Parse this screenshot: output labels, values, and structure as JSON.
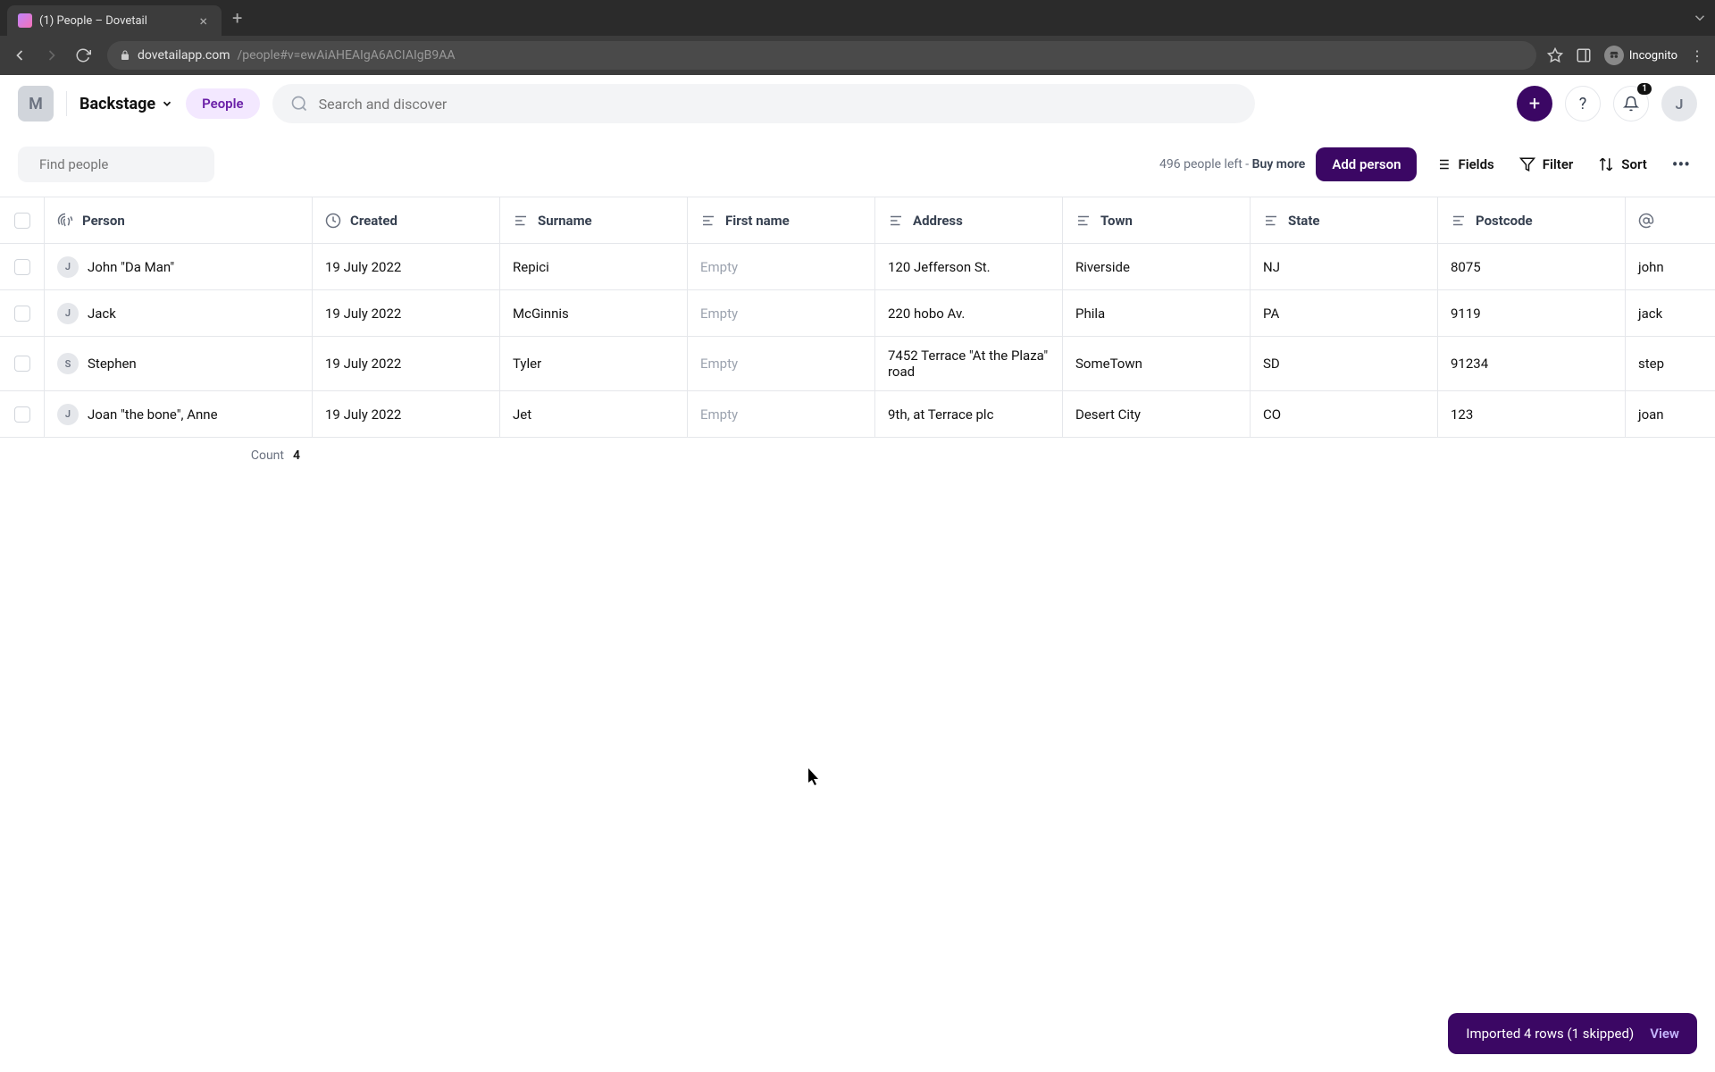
{
  "browser": {
    "tab_title": "(1) People – Dovetail",
    "url_host": "dovetailapp.com",
    "url_path": "/people#v=ewAiAHEAIgA6ACIAIgB9AA",
    "incognito_label": "Incognito"
  },
  "header": {
    "workspace_initial": "M",
    "project_name": "Backstage",
    "nav_pill": "People",
    "search_placeholder": "Search and discover",
    "notification_count": "1",
    "user_initial": "J"
  },
  "toolbar": {
    "find_placeholder": "Find people",
    "people_left_text": "496 people left - ",
    "buy_more": "Buy more",
    "add_person": "Add person",
    "fields": "Fields",
    "filter": "Filter",
    "sort": "Sort"
  },
  "columns": {
    "person": "Person",
    "created": "Created",
    "surname": "Surname",
    "first_name": "First name",
    "address": "Address",
    "town": "Town",
    "state": "State",
    "postcode": "Postcode"
  },
  "rows": [
    {
      "initial": "J",
      "person": "John \"Da Man\"",
      "created": "19 July 2022",
      "surname": "Repici",
      "first_name": "Empty",
      "address": "120 Jefferson St.",
      "town": "Riverside",
      "state": "NJ",
      "postcode": "8075",
      "email": "john"
    },
    {
      "initial": "J",
      "person": "Jack",
      "created": "19 July 2022",
      "surname": "McGinnis",
      "first_name": "Empty",
      "address": "220 hobo Av.",
      "town": "Phila",
      "state": "PA",
      "postcode": "9119",
      "email": "jack"
    },
    {
      "initial": "S",
      "person": "Stephen",
      "created": "19 July 2022",
      "surname": "Tyler",
      "first_name": "Empty",
      "address": "7452 Terrace \"At the Plaza\" road",
      "town": "SomeTown",
      "state": "SD",
      "postcode": "91234",
      "email": "step"
    },
    {
      "initial": "J",
      "person": "Joan \"the bone\", Anne",
      "created": "19 July 2022",
      "surname": "Jet",
      "first_name": "Empty",
      "address": "9th, at Terrace plc",
      "town": "Desert City",
      "state": "CO",
      "postcode": "123",
      "email": "joan"
    }
  ],
  "footer": {
    "count_label": "Count",
    "count_value": "4"
  },
  "toast": {
    "message": "Imported 4 rows (1 skipped)",
    "action": "View"
  }
}
